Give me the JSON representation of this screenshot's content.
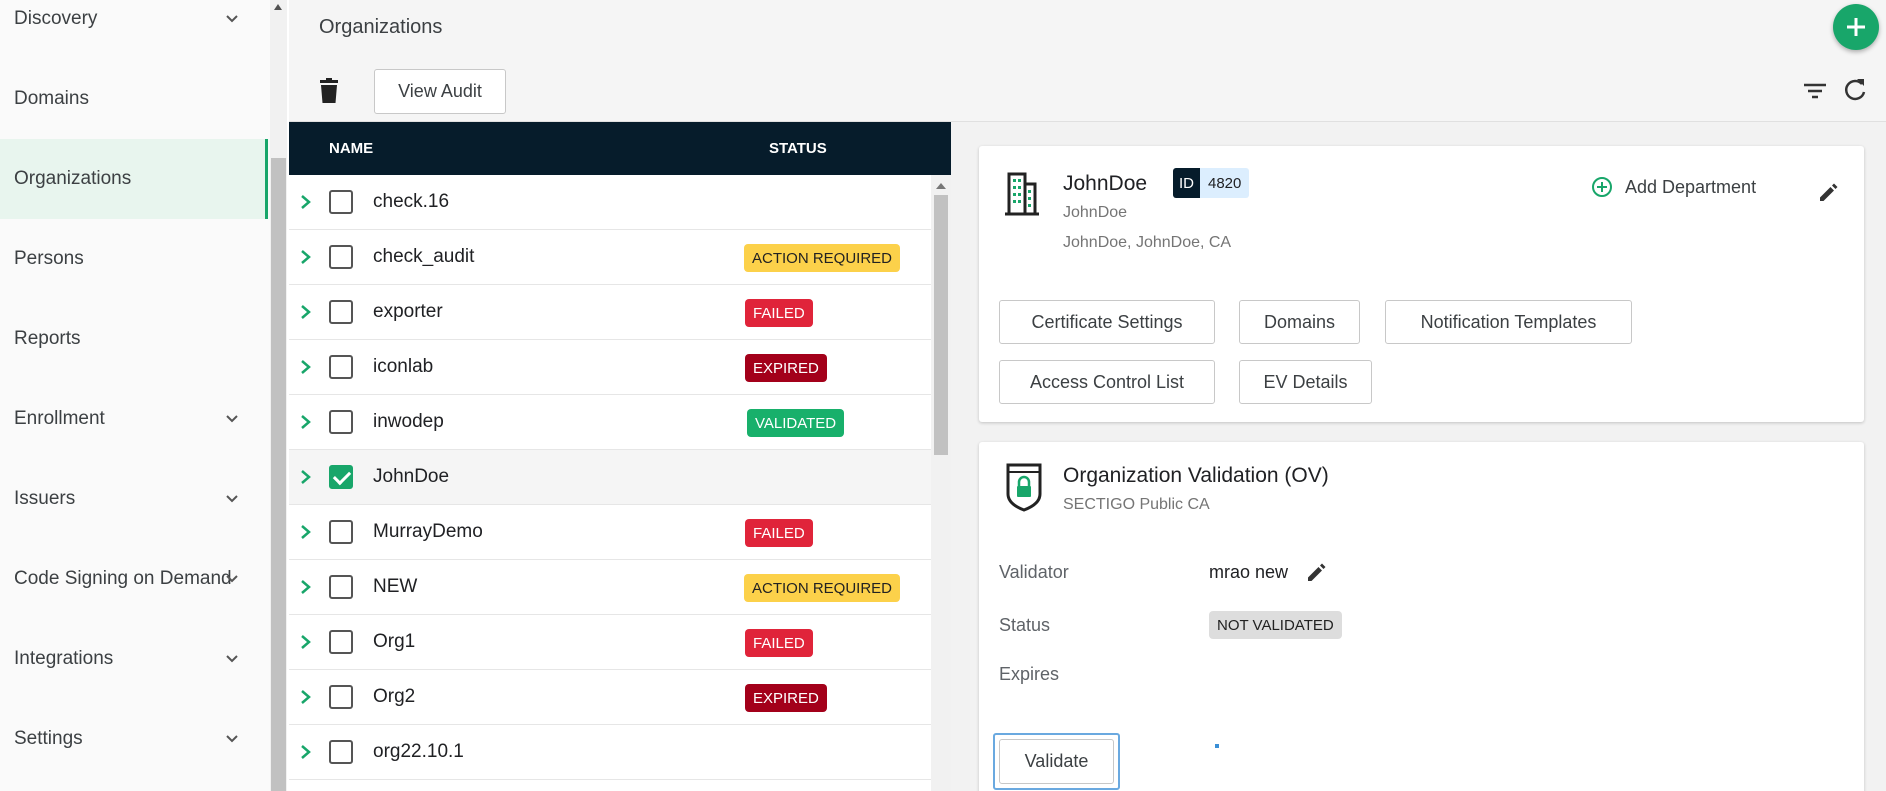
{
  "sidebar": {
    "items": [
      {
        "label": "Discovery",
        "has_chevron": true
      },
      {
        "label": "Domains",
        "has_chevron": false
      },
      {
        "label": "Organizations",
        "has_chevron": false,
        "active": true
      },
      {
        "label": "Persons",
        "has_chevron": false
      },
      {
        "label": "Reports",
        "has_chevron": false
      },
      {
        "label": "Enrollment",
        "has_chevron": true
      },
      {
        "label": "Issuers",
        "has_chevron": true
      },
      {
        "label": "Code Signing on Demand",
        "has_chevron": true
      },
      {
        "label": "Integrations",
        "has_chevron": true
      },
      {
        "label": "Settings",
        "has_chevron": true
      }
    ]
  },
  "header": {
    "title": "Organizations",
    "view_audit_label": "View Audit",
    "icons": [
      "plus-icon",
      "trash-icon",
      "filter-icon",
      "refresh-icon"
    ]
  },
  "table": {
    "col_name": "NAME",
    "col_status": "STATUS",
    "rows": [
      {
        "name": "check.16",
        "status": "",
        "checked": false
      },
      {
        "name": "check_audit",
        "status": "ACTION REQUIRED",
        "checked": false
      },
      {
        "name": "exporter",
        "status": "FAILED",
        "checked": false
      },
      {
        "name": "iconlab",
        "status": "EXPIRED",
        "checked": false
      },
      {
        "name": "inwodep",
        "status": "VALIDATED",
        "checked": false
      },
      {
        "name": "JohnDoe",
        "status": "",
        "checked": true
      },
      {
        "name": "MurrayDemo",
        "status": "FAILED",
        "checked": false
      },
      {
        "name": "NEW",
        "status": "ACTION REQUIRED",
        "checked": false
      },
      {
        "name": "Org1",
        "status": "FAILED",
        "checked": false
      },
      {
        "name": "Org2",
        "status": "EXPIRED",
        "checked": false
      },
      {
        "name": "org22.10.1",
        "status": "",
        "checked": false
      }
    ]
  },
  "org": {
    "name": "JohnDoe",
    "id_label": "ID",
    "id_value": "4820",
    "subtitle": "JohnDoe",
    "address": "JohnDoe, JohnDoe, CA",
    "add_department_label": "Add Department",
    "buttons": {
      "certificate_settings": "Certificate Settings",
      "domains": "Domains",
      "notification_templates": "Notification Templates",
      "access_control_list": "Access Control List",
      "ev_details": "EV Details"
    }
  },
  "validation": {
    "title": "Organization Validation (OV)",
    "ca": "SECTIGO Public CA",
    "validator_label": "Validator",
    "validator_value": "mrao new",
    "status_label": "Status",
    "status_value": "NOT VALIDATED",
    "expires_label": "Expires",
    "validate_label": "Validate"
  },
  "colors": {
    "accent_green": "#18a66a",
    "header_dark": "#061c2b",
    "action_required": "#fcd14a",
    "failed": "#e0243a",
    "expired": "#a3001a",
    "validated": "#18b06b"
  }
}
